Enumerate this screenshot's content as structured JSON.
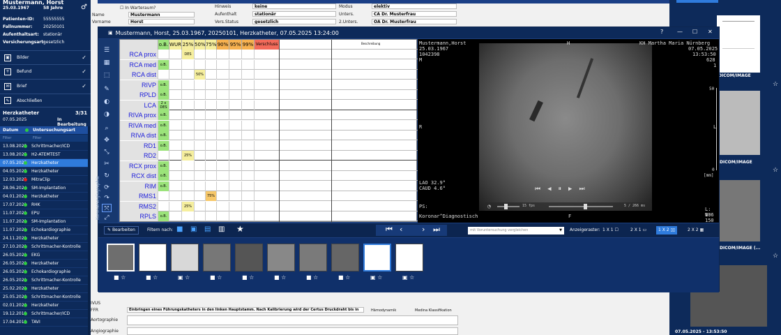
{
  "patient": {
    "name": "Mustermann, Horst",
    "dob": "25.03.1967",
    "age": "58 Jahre",
    "gender_symbol": "♂",
    "info": [
      {
        "k": "Patienten-ID:",
        "v": "55555555"
      },
      {
        "k": "Fallnummer:",
        "v": "20250101"
      },
      {
        "k": "Aufenthaltsart:",
        "v": "stationär"
      },
      {
        "k": "Versicherungsart:",
        "v": "gesetzlich"
      }
    ]
  },
  "sidebar": {
    "buttons": [
      {
        "label": "Bilder",
        "icon": "image-icon"
      },
      {
        "label": "Befund",
        "icon": "plus-doc-icon"
      },
      {
        "label": "Brief",
        "icon": "mail-icon"
      },
      {
        "label": "Abschließen",
        "icon": "edit-icon"
      }
    ],
    "section": {
      "title": "Herzkatheter",
      "count": "3/31",
      "date": "07.05.2025",
      "state": "In Bearbeitung"
    },
    "columns": {
      "date": "Datum",
      "type": "Untersuchungsart"
    },
    "filter": "Filter",
    "rows": [
      {
        "date": "13.08.2025",
        "type": "Schrittmacher/ICD",
        "color": "#2ecc40"
      },
      {
        "date": "13.08.2025",
        "type": "H2-ATEMTEST",
        "color": "#2ecc40"
      },
      {
        "date": "07.05.2025",
        "type": "Herzkatheter",
        "color": "#2ecc40",
        "selected": true
      },
      {
        "date": "04.05.2025",
        "type": "Herzkatheter",
        "color": "#2ecc40"
      },
      {
        "date": "12.03.2025",
        "type": "MitraClip",
        "color": "#e02020"
      },
      {
        "date": "28.06.2024",
        "type": "SM-Implantation",
        "color": "#2ecc40"
      },
      {
        "date": "04.01.2024",
        "type": "Herzkatheter",
        "color": "#2ecc40"
      },
      {
        "date": "17.07.2021",
        "type": "RHK",
        "color": "#2ecc40"
      },
      {
        "date": "11.07.2021",
        "type": "EPU",
        "color": "#2ecc40"
      },
      {
        "date": "11.07.2021",
        "type": "SM-Implantation",
        "color": "#2ecc40"
      },
      {
        "date": "11.07.2021",
        "type": "Echokardiographie",
        "color": "#2ecc40"
      },
      {
        "date": "24.11.2021",
        "type": "Herzkatheter",
        "color": "#2ecc40"
      },
      {
        "date": "27.10.2021",
        "type": "Schrittmacher-Kontrolle",
        "color": "#2ecc40"
      },
      {
        "date": "26.05.2021",
        "type": "EKG",
        "color": "#2ecc40"
      },
      {
        "date": "26.05.2021",
        "type": "Herzkatheter",
        "color": "#2ecc40"
      },
      {
        "date": "26.05.2021",
        "type": "Echokardiographie",
        "color": "#2ecc40"
      },
      {
        "date": "26.05.2021",
        "type": "Schrittmacher-Kontrolle",
        "color": "#2ecc40"
      },
      {
        "date": "25.02.2021",
        "type": "Herzkatheter",
        "color": "#2ecc40"
      },
      {
        "date": "25.05.2020",
        "type": "Schrittmacher-Kontrolle",
        "color": "#2ecc40"
      },
      {
        "date": "02.01.2020",
        "type": "Herzkatheter",
        "color": "#2ecc40"
      },
      {
        "date": "19.12.2019",
        "type": "Schrittmacher/ICD",
        "color": "#2ecc40"
      },
      {
        "date": "17.04.2019",
        "type": "TAVI",
        "color": "#2ecc40"
      }
    ]
  },
  "form": {
    "waitroom": "In Warteraum?",
    "fields": [
      {
        "label": "Name",
        "value": "Mustermann"
      },
      {
        "label": "Vorname",
        "value": "Horst"
      }
    ],
    "mid": [
      {
        "label": "Hinweis",
        "value": "keine"
      },
      {
        "label": "Aufenthalt",
        "value": "stationär"
      },
      {
        "label": "Vers.Status",
        "value": "gesetzlich"
      }
    ],
    "right": [
      {
        "label": "Modus",
        "value": "elektiv"
      },
      {
        "label": "Unters.",
        "value": "CA Dr. Musterfrau"
      },
      {
        "label": "2.Unters.",
        "value": "OA Dr. Musterfrau"
      }
    ],
    "bottom_labels": [
      "IVUS",
      "FFR",
      "Aortographie",
      "Angiographie"
    ],
    "ffr_text": "Einbringen eines Führungskatheters in den linken Hauptstamm. Nach Kalibrierung wird der Certus Druckdraht bis in",
    "hamo": "Hämodynamik",
    "medina": "Medina Klassifikation"
  },
  "window": {
    "title": "Mustermann, Horst, 25.03.1967, 20250101, Herzkatheter, 07.05.2025 13:24:00",
    "side_text": "Koronarangiographie",
    "grid": {
      "headers": [
        {
          "t": "o.B.",
          "c": "#9be37a"
        },
        {
          "t": "WUR",
          "c": "#f6ef9e"
        },
        {
          "t": "25%",
          "c": "#f6ef9e"
        },
        {
          "t": "50%",
          "c": "#f6ef9e"
        },
        {
          "t": "75%",
          "c": "#f6ef9e"
        },
        {
          "t": "90%",
          "c": "#f7b14f"
        },
        {
          "t": "95%",
          "c": "#f7b14f"
        },
        {
          "t": "99%",
          "c": "#f7b14f"
        },
        {
          "t": "Verschluss",
          "c": "#f36a5a"
        }
      ],
      "beschreibung": "Beschreibung",
      "rows": [
        {
          "l": "RCA prox",
          "cells": {
            "2": "DES"
          }
        },
        {
          "l": "RCA med",
          "cells": {
            "0": "o.B."
          }
        },
        {
          "l": "RCA dist",
          "cells": {
            "3": "50%"
          }
        },
        {
          "l": "RIVP",
          "cells": {
            "0": "o.B."
          }
        },
        {
          "l": "RPLD",
          "cells": {
            "0": "o.B."
          }
        },
        {
          "l": "LCA",
          "cells": {
            "0": "2 x DES"
          }
        },
        {
          "l": "RIVA prox",
          "cells": {
            "0": "o.B."
          }
        },
        {
          "l": "RIVA med",
          "cells": {
            "0": "o.B."
          }
        },
        {
          "l": "RIVA dist",
          "cells": {
            "0": "o.B."
          }
        },
        {
          "l": "RD1",
          "cells": {
            "0": "o.B."
          }
        },
        {
          "l": "RD2",
          "cells": {
            "2": "25%"
          }
        },
        {
          "l": "RCX prox",
          "cells": {
            "0": "o.B."
          }
        },
        {
          "l": "RCX dist",
          "cells": {
            "0": "o.B."
          }
        },
        {
          "l": "RIM",
          "cells": {
            "0": "o.B."
          }
        },
        {
          "l": "RMS1",
          "cells": {
            "4": "75%"
          }
        },
        {
          "l": "RMS2",
          "cells": {
            "2": "25%"
          }
        },
        {
          "l": "RPLS",
          "cells": {
            "0": "o.B."
          }
        }
      ]
    },
    "dicom": {
      "name": "Mustermann,Horst",
      "dob": "25.03.1967",
      "id": "1042398",
      "sex": "M",
      "h": "H",
      "clinic": "KH Martha Maria Nürnberg",
      "date": "07.05.2025",
      "time": "13:53:50",
      "n": "628",
      "one": "1",
      "r": "R",
      "l": "L",
      "lao": "LAO 32.9°",
      "caud": "CAUD 4.6°",
      "ps": "PS:",
      "proc": "Koronar^Diagnostisch",
      "f": "F",
      "fps": "15 fps",
      "ms": "5 / 266 ms",
      "lw1": "L: 106",
      "lw2": "W: 150",
      "scale_top": "50",
      "scale_bot": "0",
      "scale_unit": "[mm]"
    },
    "toolbar": {
      "edit": "Bearbeiten",
      "filter": "Filtern nach:",
      "compare": "mit Voruntersuchung vergleichen",
      "grid_label": "Anzeigeraster:",
      "layouts": [
        "1 X 1",
        "2 X 1",
        "1 X 2",
        "2 X 2"
      ],
      "active_layout": "1 X 2"
    }
  },
  "rpanel": {
    "label": "DICOM/IMAGE",
    "labels": [
      "DICOM/IMAGE",
      "DICOM/IMAGE (...",
      "DICOM/IMAGE (...",
      "07.05.2025 - 13:53:50"
    ],
    "side_num": "50"
  }
}
